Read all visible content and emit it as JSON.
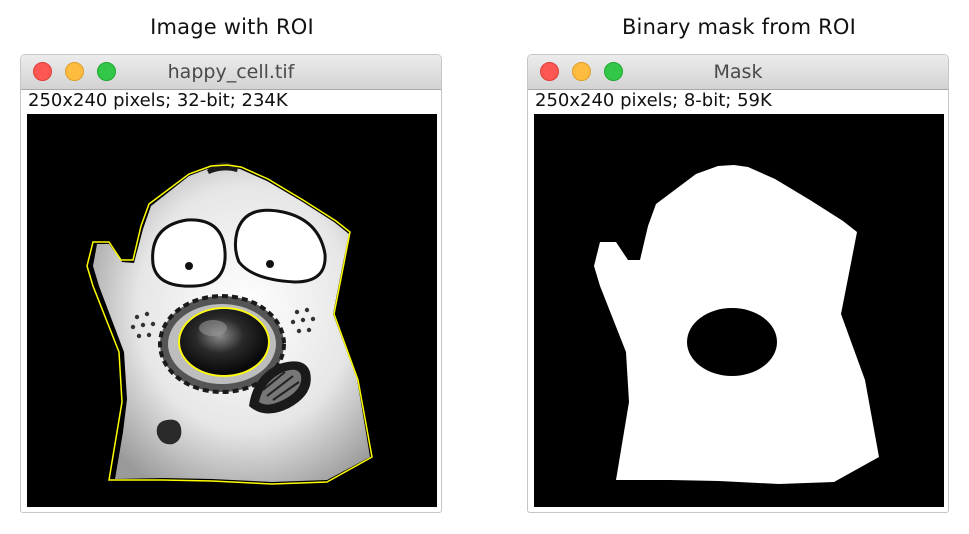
{
  "left_panel": {
    "caption": "Image with ROI",
    "window_title": "happy_cell.tif",
    "info": "250x240 pixels; 32-bit; 234K"
  },
  "right_panel": {
    "caption": "Binary mask from ROI",
    "window_title": "Mask",
    "info": "250x240 pixels; 8-bit; 59K"
  },
  "colors": {
    "roi_outline": "#ffff00",
    "canvas_background": "#000000",
    "mask_foreground": "#ffffff",
    "close_button": "#fc5753",
    "minimize_button": "#fdbc40",
    "zoom_button": "#33c748"
  },
  "icons": {
    "close": "close-traffic-light-icon",
    "minimize": "minimize-traffic-light-icon",
    "zoom": "zoom-traffic-light-icon"
  }
}
